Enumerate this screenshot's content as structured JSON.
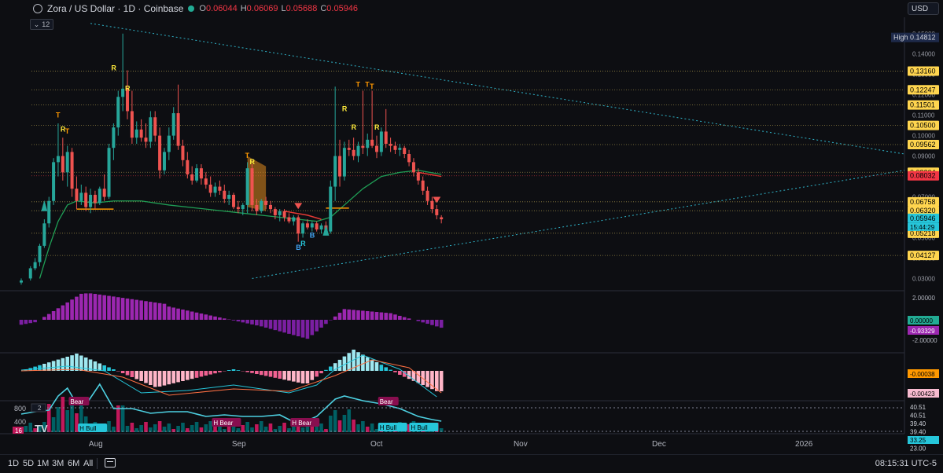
{
  "header": {
    "title": "Zora / US Dollar · 1D · Coinbase",
    "ohlc": [
      {
        "k": "O",
        "v": "0.06044"
      },
      {
        "k": "H",
        "v": "0.06069"
      },
      {
        "k": "L",
        "v": "0.05688"
      },
      {
        "k": "C",
        "v": "0.05946"
      }
    ],
    "currency": "USD",
    "collapse_count": "12"
  },
  "footer": {
    "timeframes": [
      "1D",
      "5D",
      "1M",
      "3M",
      "6M",
      "All"
    ],
    "clock": "08:15:31 UTC-5"
  },
  "colors": {
    "up": "#22ab94",
    "down": "#f23645",
    "bg": "#0d0e12",
    "purple": "#9c27b0",
    "cyan": "#5dd6e8",
    "pink": "#f06292"
  },
  "chart_data": {
    "type": "candlestick",
    "x_labels": [
      {
        "label": "Aug",
        "day": 16
      },
      {
        "label": "Sep",
        "day": 47
      },
      {
        "label": "Oct",
        "day": 77
      },
      {
        "label": "Nov",
        "day": 108
      },
      {
        "label": "Dec",
        "day": 138
      },
      {
        "label": "2026",
        "day": 169
      }
    ],
    "price_ticks": [
      "0.15000",
      "0.14000",
      "0.13000",
      "0.12000",
      "0.11000",
      "0.10000",
      "0.09000",
      "0.08000",
      "0.07000",
      "0.06000",
      "0.05000",
      "0.04000",
      "0.03000"
    ],
    "price_lines": [
      {
        "label": "0.13160",
        "v": 0.1316,
        "color": "#ffd54f",
        "fg": "#000"
      },
      {
        "label": "0.12247",
        "v": 0.12247,
        "color": "#ffd54f",
        "fg": "#000"
      },
      {
        "label": "0.11501",
        "v": 0.11501,
        "color": "#ffd54f",
        "fg": "#000"
      },
      {
        "label": "0.10500",
        "v": 0.105,
        "color": "#ffd54f",
        "fg": "#000"
      },
      {
        "label": "0.09562",
        "v": 0.09562,
        "color": "#ffd54f",
        "fg": "#000"
      },
      {
        "label": "0.08204",
        "v": 0.08204,
        "color": "#ffd54f",
        "fg": "#000"
      },
      {
        "label": "0.08032",
        "v": 0.08032,
        "color": "#f23645",
        "fg": "#000"
      },
      {
        "label": "0.06758",
        "v": 0.06758,
        "color": "#ffd54f",
        "fg": "#000"
      },
      {
        "label": "0.06320",
        "v": 0.0632,
        "color": "#ffd54f",
        "fg": "#000"
      },
      {
        "label": "0.05946",
        "v": 0.05946,
        "color": "#26c6da",
        "fg": "#000"
      },
      {
        "label": "0.05218",
        "v": 0.05218,
        "color": "#ffd54f",
        "fg": "#000"
      },
      {
        "label": "0.04127",
        "v": 0.04127,
        "color": "#ffd54f",
        "fg": "#000"
      }
    ],
    "high_label": {
      "text": "High",
      "value": "0.14812"
    },
    "countdown": "15:44:29",
    "candles": [
      {
        "d": 0,
        "o": 0.028,
        "h": 0.03,
        "l": 0.027,
        "c": 0.029
      },
      {
        "d": 2,
        "o": 0.03,
        "h": 0.036,
        "l": 0.029,
        "c": 0.035
      },
      {
        "d": 3,
        "o": 0.035,
        "h": 0.04,
        "l": 0.034,
        "c": 0.038
      },
      {
        "d": 4,
        "o": 0.038,
        "h": 0.047,
        "l": 0.036,
        "c": 0.046
      },
      {
        "d": 5,
        "o": 0.046,
        "h": 0.059,
        "l": 0.045,
        "c": 0.057
      },
      {
        "d": 6,
        "o": 0.057,
        "h": 0.07,
        "l": 0.055,
        "c": 0.068
      },
      {
        "d": 7,
        "o": 0.068,
        "h": 0.089,
        "l": 0.066,
        "c": 0.087
      },
      {
        "d": 8,
        "o": 0.087,
        "h": 0.106,
        "l": 0.08,
        "c": 0.09
      },
      {
        "d": 9,
        "o": 0.09,
        "h": 0.099,
        "l": 0.078,
        "c": 0.082
      },
      {
        "d": 10,
        "o": 0.082,
        "h": 0.095,
        "l": 0.075,
        "c": 0.092
      },
      {
        "d": 11,
        "o": 0.092,
        "h": 0.094,
        "l": 0.07,
        "c": 0.074
      },
      {
        "d": 12,
        "o": 0.074,
        "h": 0.08,
        "l": 0.064,
        "c": 0.068
      },
      {
        "d": 13,
        "o": 0.068,
        "h": 0.076,
        "l": 0.066,
        "c": 0.072
      },
      {
        "d": 14,
        "o": 0.072,
        "h": 0.075,
        "l": 0.063,
        "c": 0.065
      },
      {
        "d": 15,
        "o": 0.065,
        "h": 0.074,
        "l": 0.062,
        "c": 0.071
      },
      {
        "d": 16,
        "o": 0.071,
        "h": 0.073,
        "l": 0.064,
        "c": 0.067
      },
      {
        "d": 17,
        "o": 0.067,
        "h": 0.075,
        "l": 0.066,
        "c": 0.074
      },
      {
        "d": 18,
        "o": 0.074,
        "h": 0.081,
        "l": 0.068,
        "c": 0.07
      },
      {
        "d": 19,
        "o": 0.07,
        "h": 0.096,
        "l": 0.069,
        "c": 0.094
      },
      {
        "d": 20,
        "o": 0.094,
        "h": 0.106,
        "l": 0.088,
        "c": 0.104
      },
      {
        "d": 21,
        "o": 0.104,
        "h": 0.122,
        "l": 0.1,
        "c": 0.119
      },
      {
        "d": 22,
        "o": 0.119,
        "h": 0.15,
        "l": 0.112,
        "c": 0.123
      },
      {
        "d": 23,
        "o": 0.123,
        "h": 0.132,
        "l": 0.108,
        "c": 0.112
      },
      {
        "d": 24,
        "o": 0.112,
        "h": 0.122,
        "l": 0.096,
        "c": 0.099
      },
      {
        "d": 25,
        "o": 0.099,
        "h": 0.107,
        "l": 0.096,
        "c": 0.103
      },
      {
        "d": 26,
        "o": 0.103,
        "h": 0.108,
        "l": 0.097,
        "c": 0.099
      },
      {
        "d": 27,
        "o": 0.099,
        "h": 0.106,
        "l": 0.094,
        "c": 0.097
      },
      {
        "d": 28,
        "o": 0.097,
        "h": 0.112,
        "l": 0.094,
        "c": 0.109
      },
      {
        "d": 29,
        "o": 0.109,
        "h": 0.112,
        "l": 0.097,
        "c": 0.1
      },
      {
        "d": 30,
        "o": 0.1,
        "h": 0.104,
        "l": 0.079,
        "c": 0.083
      },
      {
        "d": 31,
        "o": 0.083,
        "h": 0.094,
        "l": 0.081,
        "c": 0.092
      },
      {
        "d": 32,
        "o": 0.092,
        "h": 0.104,
        "l": 0.088,
        "c": 0.1
      },
      {
        "d": 33,
        "o": 0.1,
        "h": 0.114,
        "l": 0.098,
        "c": 0.111
      },
      {
        "d": 34,
        "o": 0.111,
        "h": 0.125,
        "l": 0.093,
        "c": 0.095
      },
      {
        "d": 35,
        "o": 0.095,
        "h": 0.098,
        "l": 0.085,
        "c": 0.088
      },
      {
        "d": 36,
        "o": 0.088,
        "h": 0.092,
        "l": 0.079,
        "c": 0.081
      },
      {
        "d": 37,
        "o": 0.081,
        "h": 0.085,
        "l": 0.076,
        "c": 0.078
      },
      {
        "d": 38,
        "o": 0.078,
        "h": 0.086,
        "l": 0.077,
        "c": 0.084
      },
      {
        "d": 39,
        "o": 0.084,
        "h": 0.086,
        "l": 0.076,
        "c": 0.079
      },
      {
        "d": 40,
        "o": 0.079,
        "h": 0.082,
        "l": 0.074,
        "c": 0.076
      },
      {
        "d": 41,
        "o": 0.076,
        "h": 0.08,
        "l": 0.07,
        "c": 0.072
      },
      {
        "d": 42,
        "o": 0.072,
        "h": 0.077,
        "l": 0.07,
        "c": 0.075
      },
      {
        "d": 43,
        "o": 0.075,
        "h": 0.078,
        "l": 0.071,
        "c": 0.073
      },
      {
        "d": 44,
        "o": 0.073,
        "h": 0.076,
        "l": 0.067,
        "c": 0.069
      },
      {
        "d": 45,
        "o": 0.069,
        "h": 0.073,
        "l": 0.066,
        "c": 0.071
      },
      {
        "d": 46,
        "o": 0.071,
        "h": 0.072,
        "l": 0.064,
        "c": 0.065
      },
      {
        "d": 47,
        "o": 0.065,
        "h": 0.068,
        "l": 0.062,
        "c": 0.064
      },
      {
        "d": 48,
        "o": 0.064,
        "h": 0.067,
        "l": 0.061,
        "c": 0.066
      },
      {
        "d": 49,
        "o": 0.066,
        "h": 0.087,
        "l": 0.062,
        "c": 0.084
      },
      {
        "d": 50,
        "o": 0.084,
        "h": 0.086,
        "l": 0.063,
        "c": 0.066
      },
      {
        "d": 51,
        "o": 0.066,
        "h": 0.069,
        "l": 0.061,
        "c": 0.063
      },
      {
        "d": 52,
        "o": 0.063,
        "h": 0.069,
        "l": 0.062,
        "c": 0.068
      },
      {
        "d": 53,
        "o": 0.068,
        "h": 0.07,
        "l": 0.064,
        "c": 0.066
      },
      {
        "d": 54,
        "o": 0.066,
        "h": 0.068,
        "l": 0.062,
        "c": 0.064
      },
      {
        "d": 55,
        "o": 0.064,
        "h": 0.065,
        "l": 0.059,
        "c": 0.061
      },
      {
        "d": 56,
        "o": 0.061,
        "h": 0.064,
        "l": 0.058,
        "c": 0.063
      },
      {
        "d": 57,
        "o": 0.063,
        "h": 0.064,
        "l": 0.058,
        "c": 0.06
      },
      {
        "d": 58,
        "o": 0.06,
        "h": 0.062,
        "l": 0.057,
        "c": 0.058
      },
      {
        "d": 59,
        "o": 0.058,
        "h": 0.061,
        "l": 0.056,
        "c": 0.06
      },
      {
        "d": 60,
        "o": 0.06,
        "h": 0.061,
        "l": 0.048,
        "c": 0.052
      },
      {
        "d": 61,
        "o": 0.052,
        "h": 0.058,
        "l": 0.05,
        "c": 0.057
      },
      {
        "d": 62,
        "o": 0.057,
        "h": 0.059,
        "l": 0.054,
        "c": 0.055
      },
      {
        "d": 63,
        "o": 0.055,
        "h": 0.058,
        "l": 0.053,
        "c": 0.057
      },
      {
        "d": 64,
        "o": 0.057,
        "h": 0.058,
        "l": 0.053,
        "c": 0.054
      },
      {
        "d": 65,
        "o": 0.054,
        "h": 0.057,
        "l": 0.052,
        "c": 0.056
      },
      {
        "d": 66,
        "o": 0.056,
        "h": 0.058,
        "l": 0.052,
        "c": 0.053
      },
      {
        "d": 67,
        "o": 0.053,
        "h": 0.078,
        "l": 0.052,
        "c": 0.075
      },
      {
        "d": 68,
        "o": 0.075,
        "h": 0.124,
        "l": 0.068,
        "c": 0.09
      },
      {
        "d": 69,
        "o": 0.09,
        "h": 0.098,
        "l": 0.075,
        "c": 0.08
      },
      {
        "d": 70,
        "o": 0.08,
        "h": 0.097,
        "l": 0.078,
        "c": 0.094
      },
      {
        "d": 71,
        "o": 0.094,
        "h": 0.098,
        "l": 0.09,
        "c": 0.093
      },
      {
        "d": 72,
        "o": 0.093,
        "h": 0.099,
        "l": 0.088,
        "c": 0.09
      },
      {
        "d": 73,
        "o": 0.09,
        "h": 0.097,
        "l": 0.087,
        "c": 0.095
      },
      {
        "d": 74,
        "o": 0.095,
        "h": 0.122,
        "l": 0.091,
        "c": 0.094
      },
      {
        "d": 75,
        "o": 0.094,
        "h": 0.101,
        "l": 0.09,
        "c": 0.098
      },
      {
        "d": 76,
        "o": 0.098,
        "h": 0.122,
        "l": 0.094,
        "c": 0.095
      },
      {
        "d": 77,
        "o": 0.095,
        "h": 0.1,
        "l": 0.089,
        "c": 0.092
      },
      {
        "d": 78,
        "o": 0.092,
        "h": 0.104,
        "l": 0.09,
        "c": 0.102
      },
      {
        "d": 79,
        "o": 0.102,
        "h": 0.113,
        "l": 0.094,
        "c": 0.096
      },
      {
        "d": 80,
        "o": 0.096,
        "h": 0.099,
        "l": 0.092,
        "c": 0.095
      },
      {
        "d": 81,
        "o": 0.095,
        "h": 0.097,
        "l": 0.091,
        "c": 0.093
      },
      {
        "d": 82,
        "o": 0.093,
        "h": 0.096,
        "l": 0.09,
        "c": 0.094
      },
      {
        "d": 83,
        "o": 0.094,
        "h": 0.095,
        "l": 0.089,
        "c": 0.091
      },
      {
        "d": 84,
        "o": 0.091,
        "h": 0.093,
        "l": 0.085,
        "c": 0.087
      },
      {
        "d": 85,
        "o": 0.087,
        "h": 0.089,
        "l": 0.08,
        "c": 0.082
      },
      {
        "d": 86,
        "o": 0.082,
        "h": 0.084,
        "l": 0.076,
        "c": 0.078
      },
      {
        "d": 87,
        "o": 0.078,
        "h": 0.08,
        "l": 0.071,
        "c": 0.073
      },
      {
        "d": 88,
        "o": 0.073,
        "h": 0.075,
        "l": 0.066,
        "c": 0.068
      },
      {
        "d": 89,
        "o": 0.068,
        "h": 0.07,
        "l": 0.062,
        "c": 0.064
      },
      {
        "d": 90,
        "o": 0.064,
        "h": 0.066,
        "l": 0.059,
        "c": 0.061
      },
      {
        "d": 91,
        "o": 0.06,
        "h": 0.061,
        "l": 0.057,
        "c": 0.059
      }
    ],
    "signals": [
      {
        "d": 8,
        "v": 0.109,
        "t": "T",
        "color": "#ff9800"
      },
      {
        "d": 10,
        "v": 0.101,
        "t": "T",
        "color": "#ff9800"
      },
      {
        "d": 20,
        "v": 0.132,
        "t": "R",
        "color": "#ffeb3b"
      },
      {
        "d": 23,
        "v": 0.122,
        "t": "R",
        "color": "#ffeb3b"
      },
      {
        "d": 9,
        "v": 0.102,
        "t": "R",
        "color": "#ffeb3b"
      },
      {
        "d": 49,
        "v": 0.089,
        "t": "T",
        "color": "#ff9800"
      },
      {
        "d": 50,
        "v": 0.086,
        "t": "R",
        "color": "#ffeb3b"
      },
      {
        "d": 70,
        "v": 0.112,
        "t": "R",
        "color": "#ffeb3b"
      },
      {
        "d": 72,
        "v": 0.103,
        "t": "R",
        "color": "#ffeb3b"
      },
      {
        "d": 73,
        "v": 0.124,
        "t": "T",
        "color": "#ff9800"
      },
      {
        "d": 75,
        "v": 0.124,
        "t": "T",
        "color": "#ff9800"
      },
      {
        "d": 76,
        "v": 0.123,
        "t": "T",
        "color": "#ff9800"
      },
      {
        "d": 77,
        "v": 0.103,
        "t": "R",
        "color": "#ffeb3b"
      },
      {
        "d": 61,
        "v": 0.046,
        "t": "R",
        "color": "#26c6da"
      },
      {
        "d": 60,
        "v": 0.044,
        "t": "B",
        "color": "#42a5f5"
      },
      {
        "d": 63,
        "v": 0.05,
        "t": "B",
        "color": "#42a5f5"
      }
    ],
    "oscillator": {
      "range": [
        "2.00000",
        "-2.00000"
      ],
      "labels": [
        "0.00000",
        "-0.93329"
      ]
    },
    "macd": {
      "labels": [
        "-0.00038",
        "-0.00423"
      ]
    },
    "volume_panel": {
      "scale": [
        "800",
        "400"
      ],
      "right_labels": [
        "40.51",
        "40.51",
        "39.40",
        "39.40",
        "33.25",
        "23.00"
      ],
      "badges": [
        {
          "text": "Bear",
          "d": 12,
          "type": "bear"
        },
        {
          "text": "H Bull",
          "d": 14,
          "type": "bull"
        },
        {
          "text": "H Bear",
          "d": 43,
          "type": "bear"
        },
        {
          "text": "H Bear",
          "d": 60,
          "type": "bear"
        },
        {
          "text": "Bear",
          "d": 79,
          "type": "bear"
        },
        {
          "text": "H Bull",
          "d": 79,
          "type": "bull"
        },
        {
          "text": "H Bull",
          "d": 82,
          "type": "bull"
        }
      ],
      "left_badge": "16",
      "collapse_count": "2"
    },
    "watermark": "TV"
  }
}
